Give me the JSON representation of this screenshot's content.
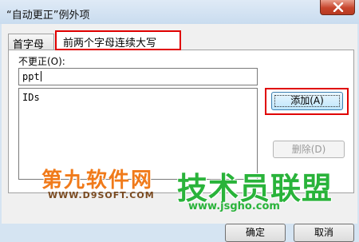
{
  "window": {
    "title": "“自动更正”例外项",
    "close_icon": "close-icon"
  },
  "tabs": [
    {
      "label": "首字母",
      "active": false
    },
    {
      "label": "前两个字母连续大写",
      "active": true
    }
  ],
  "panel": {
    "field_label": "不更正(O):",
    "input_value": "ppt",
    "list_items": [
      "IDs"
    ]
  },
  "buttons": {
    "add": "添加(A)",
    "delete": "删除(D)",
    "ok": "确定",
    "cancel": "取消"
  },
  "watermark": {
    "left_text": "第九软件网",
    "left_url": "WWW.D9SOFT.COM",
    "right_text": "技术员联盟",
    "right_url": "www.jsgho.com"
  },
  "colors": {
    "highlight": "#e00000",
    "title_bar": "#d5e4f2",
    "watermark_green": "#29b33a",
    "watermark_orange": "#f07a1a"
  }
}
